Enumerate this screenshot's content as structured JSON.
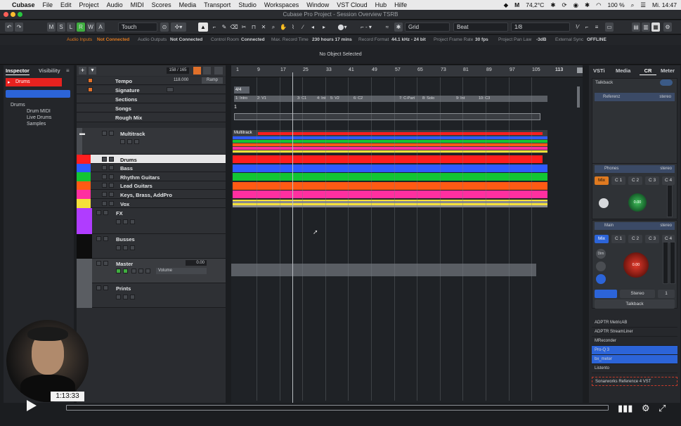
{
  "menubar": {
    "apple": "",
    "items": [
      "Cubase",
      "File",
      "Edit",
      "Project",
      "Audio",
      "MIDI",
      "Scores",
      "Media",
      "Transport",
      "Studio",
      "Workspaces",
      "Window",
      "VST Cloud",
      "Hub",
      "Hilfe"
    ],
    "temp": "74,2°C",
    "battery": "100 %",
    "clock": "Mi. 14:47"
  },
  "window": {
    "title": "Cubase Pro Project - Session Overview TSRB"
  },
  "toolbar": {
    "msbuttons": [
      "M",
      "S",
      "L",
      "R",
      "W",
      "A"
    ],
    "automation_mode": "Touch",
    "snap_type": "Grid",
    "grid_type": "Beat",
    "quantize": "1/8"
  },
  "infoline": {
    "audio_inputs_label": "Audio Inputs",
    "audio_inputs_value": "Not Connected",
    "audio_outputs_label": "Audio Outputs",
    "audio_outputs_value": "Not Connected",
    "control_room_label": "Control Room",
    "control_room_value": "Connected",
    "max_record_label": "Max. Record Time",
    "max_record_value": "230 hours 17 mins",
    "record_format_label": "Record Format",
    "record_format_value": "44.1 kHz - 24 bit",
    "frame_rate_label": "Project Frame Rate",
    "frame_rate_value": "30 fps",
    "pan_law_label": "Project Pan Law",
    "pan_law_value": "-3dB",
    "ext_sync_label": "External Sync",
    "ext_sync_value": "OFFLINE"
  },
  "status": {
    "selection": "No Object Selected"
  },
  "inspector": {
    "tabs": [
      "Inspector",
      "Visibility"
    ],
    "track_name": "Drums",
    "tree": [
      "Drums",
      "Drum MIDI",
      "Live Drums",
      "Samples"
    ]
  },
  "tracklist": {
    "count": "158 / 165",
    "global_tracks": [
      {
        "name": "Tempo",
        "value": "118.000",
        "mode": "Ramp"
      },
      {
        "name": "Signature"
      },
      {
        "name": "Sections"
      },
      {
        "name": "Songs"
      },
      {
        "name": "Rough Mix"
      }
    ],
    "folders": [
      {
        "name": "Multitrack"
      },
      {
        "name": "Drums",
        "color": "#ff1e1e"
      },
      {
        "name": "Bass",
        "color": "#2f5bff"
      },
      {
        "name": "Rhythm Guitars",
        "color": "#13c534"
      },
      {
        "name": "Lead Guitars",
        "color": "#ff5a14"
      },
      {
        "name": "Keys, Brass, AddPro",
        "color": "#ff2fa0"
      },
      {
        "name": "Vox",
        "color": "#f5e03a"
      },
      {
        "name": "FX",
        "color": "#b03cff"
      },
      {
        "name": "Busses"
      },
      {
        "name": "Master",
        "value": "0.00",
        "automation": "Volume"
      },
      {
        "name": "Prints"
      }
    ]
  },
  "ruler": {
    "bars": [
      "1",
      "9",
      "17",
      "25",
      "33",
      "41",
      "49",
      "57",
      "65",
      "73",
      "81",
      "89",
      "97",
      "105",
      "113"
    ],
    "signature": "4/4",
    "sections": [
      "1: Intro",
      "2: V1",
      "3: C1",
      "4: Int",
      "5: V2",
      "6: C2",
      "7: C-Part",
      "8: Solo",
      "9: Int",
      "10: C3"
    ],
    "multitrack_label": "Multitrack"
  },
  "rightzone": {
    "tabs": [
      "VSTi",
      "Media",
      "CR",
      "Meter"
    ],
    "talkback_header": "Talkback",
    "referenz": "Referenz",
    "referenz_fmt": "stereo",
    "phones": "Phones",
    "phones_fmt": "stereo",
    "phones_buttons": [
      "Mix",
      "C 1",
      "C 2",
      "C 3",
      "C 4"
    ],
    "phones_level": "0.00",
    "main": "Main",
    "main_fmt": "stereo",
    "main_buttons": [
      "Mix",
      "C 1",
      "C 2",
      "C 3",
      "C 4"
    ],
    "main_level": "0.00",
    "dim": "Dim",
    "output_mode": "Stereo",
    "output_num": "1",
    "talkback_button": "Talkback",
    "plugins": [
      "ADPTR MetricAB",
      "ADPTR StreamLiner",
      "MReconder",
      "Pro-Q 3",
      "bx_meter",
      "Listento",
      "Sonarworks Reference 4 VST"
    ]
  },
  "video": {
    "timecode": "1:13:33"
  },
  "colors": {
    "drums": "#ff1e1e",
    "bass": "#2f5bff",
    "rhythm": "#13c534",
    "lead": "#ff5a14",
    "keys": "#ff2fa0",
    "vox": "#f5e03a",
    "fx": "#b03cff",
    "selected_input": "#2c64d8"
  }
}
